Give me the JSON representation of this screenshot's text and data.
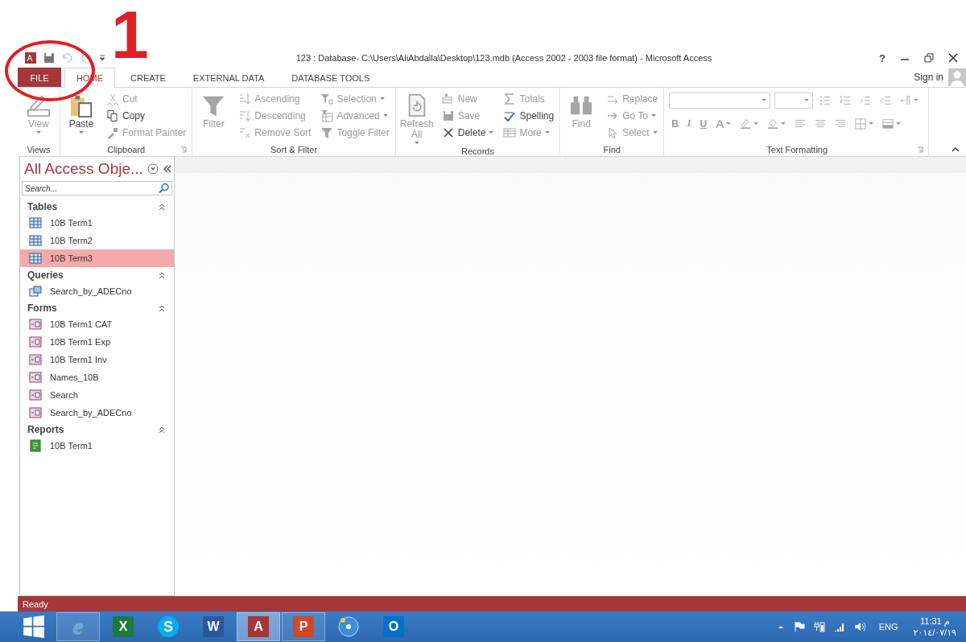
{
  "title_bar": {
    "title": "123 : Database- C:\\Users\\AliAbdalla\\Desktop\\123.mdb (Access 2002 - 2003 file format) - Microsoft Access",
    "help": "?"
  },
  "account": {
    "label": "Sign in"
  },
  "tabs": [
    {
      "label": "FILE",
      "kind": "file",
      "selected": false
    },
    {
      "label": "HOME",
      "kind": "tab",
      "selected": true
    },
    {
      "label": "CREATE",
      "kind": "tab",
      "selected": false
    },
    {
      "label": "EXTERNAL DATA",
      "kind": "tab",
      "selected": false
    },
    {
      "label": "DATABASE TOOLS",
      "kind": "tab",
      "selected": false
    }
  ],
  "ribbon": {
    "groups": [
      {
        "label": "Views",
        "launcher": false,
        "columns": [
          {
            "buttons": [
              {
                "label": "View",
                "kind": "large",
                "disabled": true,
                "dropdown": true
              }
            ]
          }
        ]
      },
      {
        "label": "Clipboard",
        "launcher": true,
        "columns": [
          {
            "buttons": [
              {
                "label": "Paste",
                "kind": "large",
                "disabled": false,
                "dropdown": true
              }
            ]
          },
          {
            "buttons": [
              {
                "label": "Cut",
                "kind": "small",
                "disabled": true,
                "dropdown": false
              },
              {
                "label": "Copy",
                "kind": "small",
                "disabled": false,
                "dropdown": false
              },
              {
                "label": "Format Painter",
                "kind": "small",
                "disabled": true,
                "dropdown": false
              }
            ]
          }
        ]
      },
      {
        "label": "Sort & Filter",
        "launcher": false,
        "columns": [
          {
            "buttons": [
              {
                "label": "Filter",
                "kind": "large",
                "disabled": true,
                "dropdown": false
              }
            ]
          },
          {
            "buttons": [
              {
                "label": "Ascending",
                "kind": "small",
                "disabled": true,
                "dropdown": false
              },
              {
                "label": "Descending",
                "kind": "small",
                "disabled": true,
                "dropdown": false
              },
              {
                "label": "Remove Sort",
                "kind": "small",
                "disabled": true,
                "dropdown": false
              }
            ]
          },
          {
            "buttons": [
              {
                "label": "Selection",
                "kind": "small",
                "disabled": true,
                "dropdown": true
              },
              {
                "label": "Advanced",
                "kind": "small",
                "disabled": true,
                "dropdown": true
              },
              {
                "label": "Toggle Filter",
                "kind": "small",
                "disabled": true,
                "dropdown": false
              }
            ]
          }
        ]
      },
      {
        "label": "Records",
        "launcher": false,
        "columns": [
          {
            "buttons": [
              {
                "label": "Refresh All",
                "kind": "large",
                "disabled": true,
                "dropdown": true
              }
            ]
          },
          {
            "buttons": [
              {
                "label": "New",
                "kind": "small",
                "disabled": true,
                "dropdown": false
              },
              {
                "label": "Save",
                "kind": "small",
                "disabled": true,
                "dropdown": false
              },
              {
                "label": "Delete",
                "kind": "small",
                "disabled": false,
                "dropdown": true
              }
            ]
          },
          {
            "buttons": [
              {
                "label": "Totals",
                "kind": "small",
                "disabled": true,
                "dropdown": false
              },
              {
                "label": "Spelling",
                "kind": "small",
                "disabled": false,
                "dropdown": false
              },
              {
                "label": "More",
                "kind": "small",
                "disabled": true,
                "dropdown": true
              }
            ]
          }
        ]
      },
      {
        "label": "Find",
        "launcher": false,
        "columns": [
          {
            "buttons": [
              {
                "label": "Find",
                "kind": "large",
                "disabled": true,
                "dropdown": false
              }
            ]
          },
          {
            "buttons": [
              {
                "label": "Replace",
                "kind": "small",
                "disabled": true,
                "dropdown": false
              },
              {
                "label": "Go To",
                "kind": "small",
                "disabled": true,
                "dropdown": true
              },
              {
                "label": "Select",
                "kind": "small",
                "disabled": true,
                "dropdown": true
              }
            ]
          }
        ]
      }
    ],
    "text_formatting": {
      "label": "Text Formatting",
      "launcher": true,
      "rows": [
        [
          {
            "kind": "font-field",
            "disabled": true,
            "dropdown": true
          },
          {
            "kind": "size-field",
            "disabled": true,
            "dropdown": true
          },
          {
            "kind": "icon",
            "disabled": true,
            "dropdown": false
          },
          {
            "kind": "icon",
            "disabled": true,
            "dropdown": false
          },
          {
            "kind": "icon",
            "disabled": true,
            "dropdown": false
          },
          {
            "kind": "icon",
            "disabled": true,
            "dropdown": false
          },
          {
            "kind": "icon",
            "disabled": true,
            "dropdown": true
          }
        ],
        [
          {
            "kind": "text",
            "label": "B",
            "disabled": true,
            "dropdown": false
          },
          {
            "kind": "text",
            "label": "I",
            "disabled": true,
            "dropdown": false
          },
          {
            "kind": "text",
            "label": "U",
            "disabled": true,
            "dropdown": false
          },
          {
            "kind": "text",
            "label": "A",
            "disabled": true,
            "dropdown": true
          },
          {
            "kind": "icon",
            "disabled": true,
            "dropdown": true
          },
          {
            "kind": "icon",
            "disabled": true,
            "dropdown": true
          },
          {
            "kind": "icon",
            "disabled": true,
            "dropdown": false
          },
          {
            "kind": "icon",
            "disabled": true,
            "dropdown": false
          },
          {
            "kind": "icon",
            "disabled": true,
            "dropdown": false
          },
          {
            "kind": "icon",
            "disabled": true,
            "dropdown": true
          },
          {
            "kind": "icon",
            "disabled": true,
            "dropdown": true
          }
        ]
      ]
    }
  },
  "annotation": {
    "number": "1"
  },
  "nav_pane": {
    "title": "All Access Obje...",
    "search": {
      "placeholder": "Search..."
    },
    "groups": [
      {
        "title": "Tables",
        "kind": "table",
        "items": [
          {
            "label": "10B Term1",
            "selected": false
          },
          {
            "label": "10B Term2",
            "selected": false
          },
          {
            "label": "10B Term3",
            "selected": true
          }
        ]
      },
      {
        "title": "Queries",
        "kind": "query",
        "items": [
          {
            "label": "Search_by_ADECno",
            "selected": false
          }
        ]
      },
      {
        "title": "Forms",
        "kind": "form",
        "items": [
          {
            "label": "10B Term1 CAT",
            "selected": false
          },
          {
            "label": "10B Term1 Exp",
            "selected": false
          },
          {
            "label": "10B Term1 Inv",
            "selected": false
          },
          {
            "label": "Names_10B",
            "selected": false
          },
          {
            "label": "Search",
            "selected": false
          },
          {
            "label": "Search_by_ADECno",
            "selected": false
          }
        ]
      },
      {
        "title": "Reports",
        "kind": "report",
        "items": [
          {
            "label": "10B Term1",
            "selected": false
          }
        ]
      }
    ]
  },
  "status_bar": {
    "text": "Ready"
  },
  "taskbar": {
    "apps": [
      {
        "kind": "ie",
        "glyph": "e",
        "running": true,
        "selected": false
      },
      {
        "kind": "excel",
        "glyph": "X",
        "running": false,
        "selected": false
      },
      {
        "kind": "skype",
        "glyph": "S",
        "running": false,
        "selected": false
      },
      {
        "kind": "word",
        "glyph": "W",
        "running": false,
        "selected": false
      },
      {
        "kind": "access",
        "glyph": "A",
        "running": true,
        "selected": true
      },
      {
        "kind": "powerpoint",
        "glyph": "P",
        "running": true,
        "selected": false
      },
      {
        "kind": "media",
        "running": false,
        "selected": false
      },
      {
        "kind": "outlook",
        "glyph": "O",
        "running": false,
        "selected": false
      }
    ],
    "language": "ENG",
    "time": "11:31 م",
    "date": "٢٠١٤/٠٧/١٩"
  }
}
